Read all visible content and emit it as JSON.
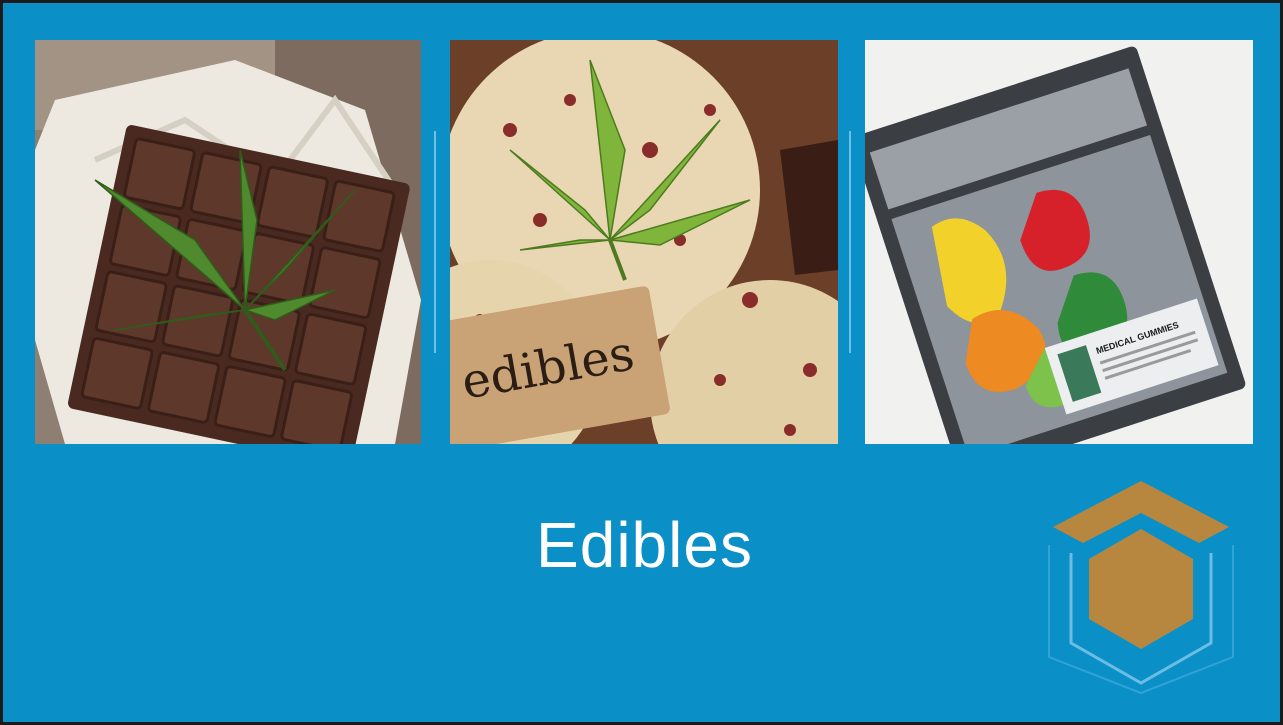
{
  "slide": {
    "title": "Edibles",
    "background_color": "#0a8fc7",
    "accent_color": "#b8873f"
  },
  "images": [
    {
      "icon": "chocolate-bar-with-leaf-photo"
    },
    {
      "icon": "cookies-with-edibles-tag-photo",
      "tag_text": "edibles"
    },
    {
      "icon": "gummies-packet-photo",
      "label_text": "MEDICAL GUMMIES"
    }
  ]
}
